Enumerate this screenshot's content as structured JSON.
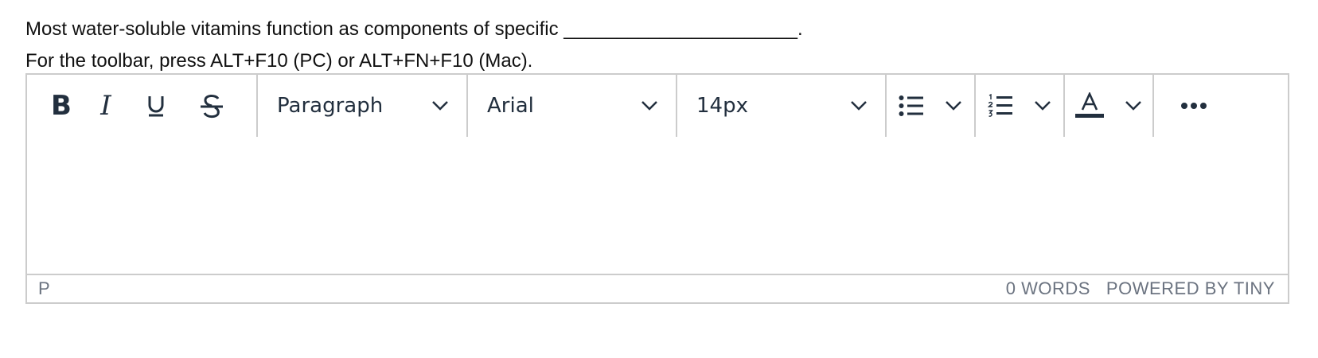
{
  "question": {
    "text": "Most water-soluble vitamins function as components of specific ______________________."
  },
  "instructions": {
    "text": "For the toolbar, press ALT+F10 (PC) or ALT+FN+F10 (Mac)."
  },
  "toolbar": {
    "bold_label": "B",
    "italic_label": "I",
    "underline_label": "U",
    "strike_label": "S",
    "block_format": "Paragraph",
    "font_family": "Arial",
    "font_size": "14px",
    "icons": [
      "bullet-list-icon",
      "numbered-list-icon",
      "text-color-icon",
      "more-icon"
    ]
  },
  "statusbar": {
    "element_path": "P",
    "word_count": "0 WORDS",
    "branding": "POWERED BY TINY"
  },
  "colors": {
    "icon": "#222f3e",
    "border": "#cccccc",
    "muted": "#6b7380"
  }
}
